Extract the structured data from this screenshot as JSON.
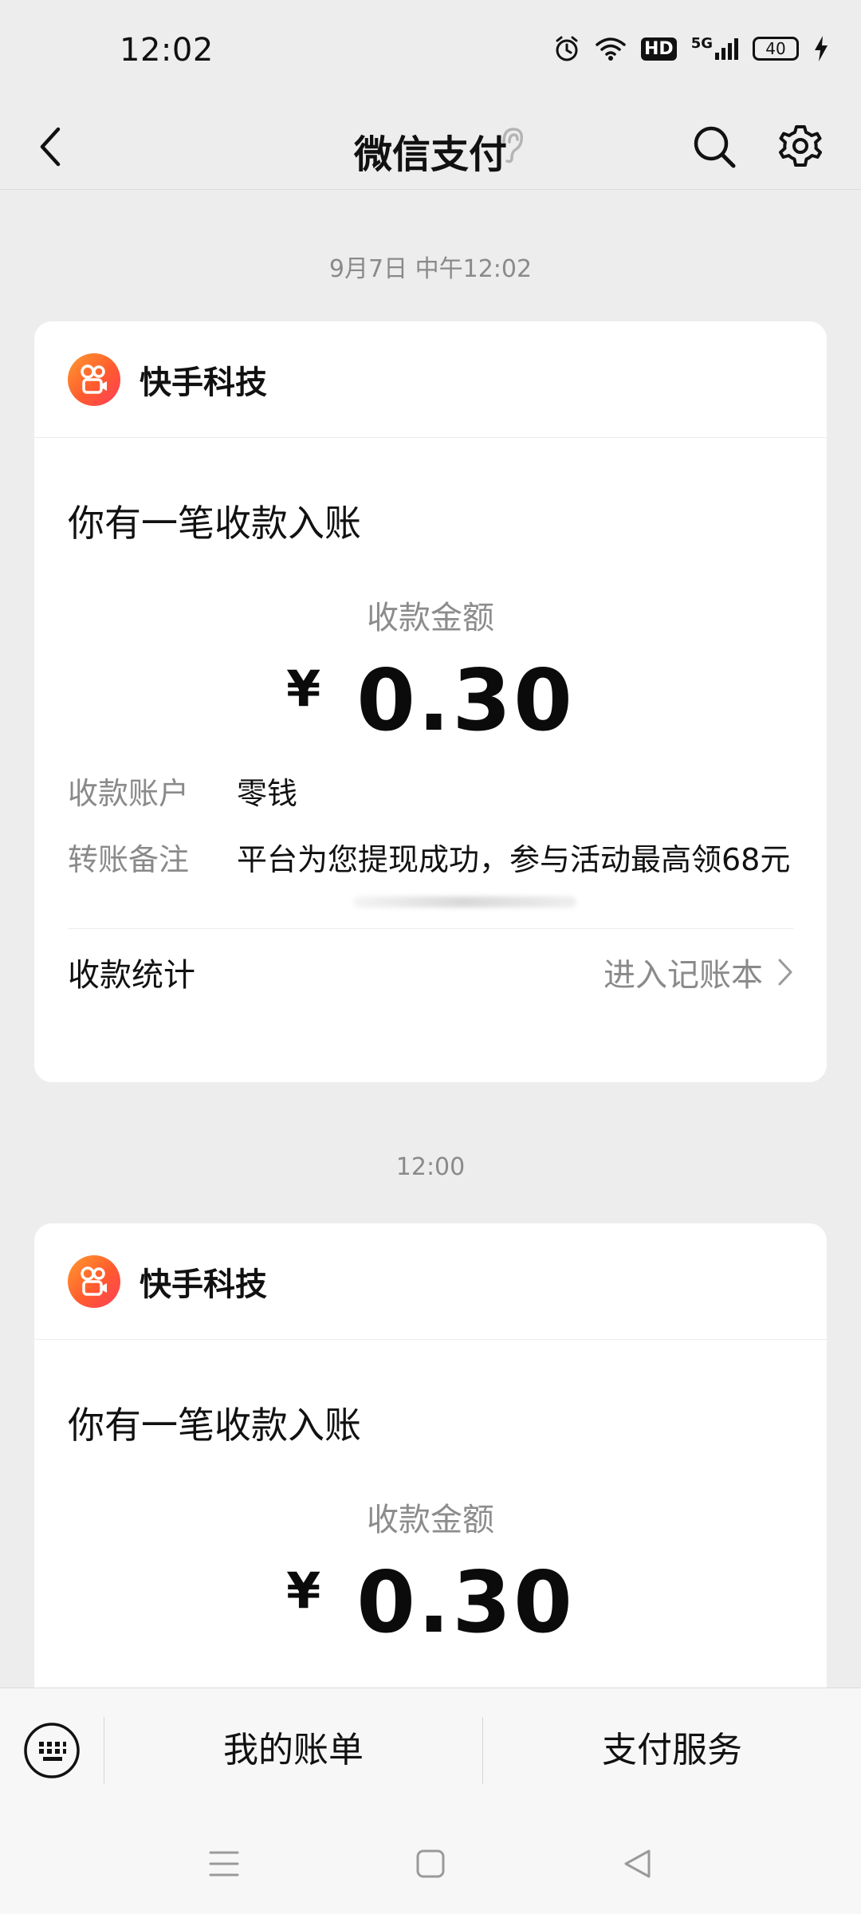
{
  "status_bar": {
    "time": "12:02",
    "network": "5G",
    "hd": "HD",
    "battery": "40"
  },
  "header": {
    "title": "微信支付"
  },
  "messages": [
    {
      "timestamp": "9月7日 中午12:02",
      "merchant": "快手科技",
      "notice": "你有一笔收款入账",
      "amount_label": "收款金额",
      "currency": "¥",
      "amount": "0.30",
      "account_key": "收款账户",
      "account_val": "零钱",
      "remark_key": "转账备注",
      "remark_val": "平台为您提现成功，参与活动最高领68元",
      "stats_label": "收款统计",
      "stats_link": "进入记账本"
    },
    {
      "timestamp": "12:00",
      "merchant": "快手科技",
      "notice": "你有一笔收款入账",
      "amount_label": "收款金额",
      "currency": "¥",
      "amount": "0.30"
    }
  ],
  "menu": {
    "bills": "我的账单",
    "services": "支付服务"
  }
}
